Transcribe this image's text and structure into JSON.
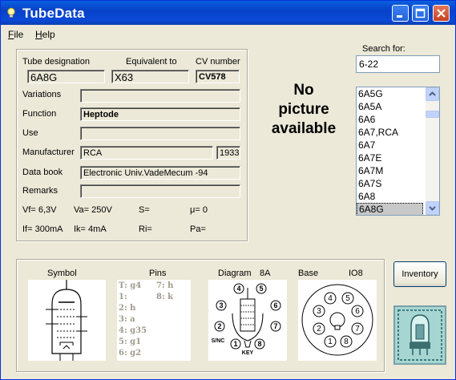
{
  "window": {
    "title": "TubeData",
    "minimize_label": "",
    "maximize_label": "",
    "close_label": ""
  },
  "menu": {
    "file": "File",
    "help": "Help"
  },
  "details": {
    "designation_label": "Tube designation",
    "equivalent_label": "Equivalent to",
    "cv_label": "CV number",
    "designation": "6A8G",
    "equivalent": "X63",
    "cv": "CV578",
    "variations_label": "Variations",
    "variations": "",
    "function_label": "Function",
    "function": "Heptode",
    "use_label": "Use",
    "use": "",
    "manufacturer_label": "Manufacturer",
    "manufacturer": "RCA",
    "year": "1933",
    "databook_label": "Data book",
    "databook": "Electronic Univ.VadeMecum -94",
    "remarks_label": "Remarks",
    "remarks": "",
    "vf": "Vf= 6,3V",
    "va": "Va=  250V",
    "s": "S=",
    "mu": "μ=    0",
    "if": "If= 300mA",
    "ik": "Ik=   4mA",
    "ri": "Ri=",
    "pa": "Pa="
  },
  "picture": {
    "line1": "No",
    "line2": "picture",
    "line3": "available"
  },
  "search": {
    "label": "Search for:",
    "value": "6-22"
  },
  "tube_list": {
    "items": [
      "6A5G",
      "6A5A",
      "6A6",
      "6A7,RCA",
      "6A7",
      "6A7E",
      "6A7M",
      "6A7S",
      "6A8",
      "6A8G"
    ],
    "selected": "6A8G"
  },
  "bottom": {
    "symbol_label": "Symbol",
    "pins_label": "Pins",
    "diagram_label": "Diagram",
    "diagram_code": "8A",
    "base_label": "Base",
    "base_code": "IO8",
    "pins": [
      {
        "left": "T: g4",
        "right": "7: h"
      },
      {
        "left": "1:",
        "right": "8: k"
      },
      {
        "left": "2: h",
        "right": ""
      },
      {
        "left": "3: a",
        "right": ""
      },
      {
        "left": "4: g35",
        "right": ""
      },
      {
        "left": "5: g1",
        "right": ""
      },
      {
        "left": "6: g2",
        "right": ""
      }
    ],
    "diagram_pins": [
      "1",
      "2",
      "3",
      "4",
      "5",
      "6",
      "7",
      "8"
    ],
    "diagram_snc": "S/NC",
    "diagram_key": "KEY",
    "base_pins": [
      "1",
      "2",
      "3",
      "4",
      "5",
      "6",
      "7",
      "8"
    ]
  },
  "inventory": {
    "label": "Inventory"
  }
}
